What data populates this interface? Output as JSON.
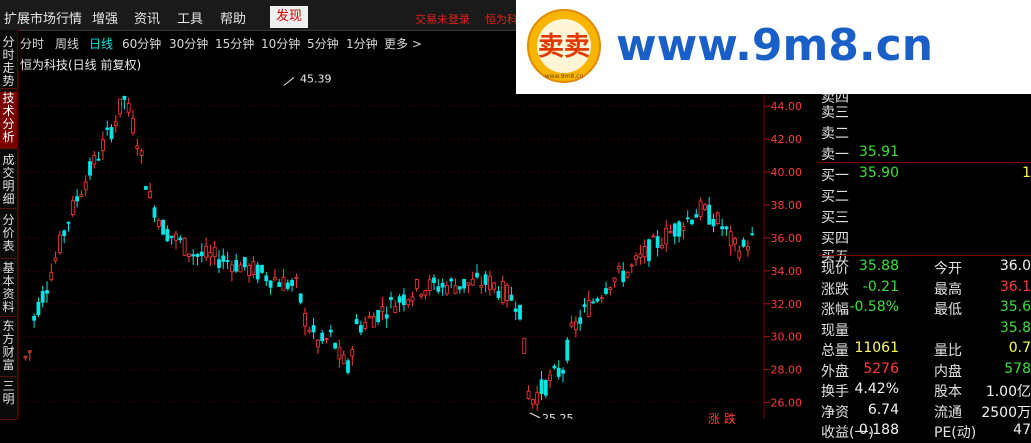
{
  "menu": {
    "items": [
      "扩展市场行情",
      "增强",
      "资讯",
      "工具",
      "帮助"
    ],
    "active": "发现",
    "login_status": "交易未登录",
    "stock_short": "恒为科"
  },
  "left_tabs": [
    "分时走势",
    "技术分析",
    "成交明细",
    "分价表",
    "基本资料",
    "东方财富",
    "三明"
  ],
  "periods": [
    "分时",
    "周线",
    "日线",
    "60分钟",
    "30分钟",
    "15分钟",
    "10分钟",
    "5分钟",
    "1分钟",
    "更多 >"
  ],
  "active_period": "日线",
  "chart_title": "恒为科技(日线 前复权)",
  "chart_data": {
    "type": "candlestick",
    "y_ticks": [
      26.0,
      28.0,
      30.0,
      32.0,
      34.0,
      36.0,
      38.0,
      40.0,
      42.0,
      44.0
    ],
    "ylim": [
      25.0,
      46.2
    ],
    "annotations": [
      {
        "label": "45.39",
        "value": 45.39
      },
      {
        "label": "25.25",
        "value": 25.25
      }
    ],
    "up_color": "#ff3b3b",
    "down_color": "#00e5e5"
  },
  "quote": {
    "asks": [
      {
        "label": "卖四",
        "price": "",
        "vol": ""
      },
      {
        "label": "卖三",
        "price": "",
        "vol": ""
      },
      {
        "label": "卖二",
        "price": "",
        "vol": ""
      },
      {
        "label": "卖一",
        "price": "35.91",
        "vol": ""
      }
    ],
    "bids": [
      {
        "label": "买一",
        "price": "35.90",
        "vol": "1"
      },
      {
        "label": "买二",
        "price": "",
        "vol": ""
      },
      {
        "label": "买三",
        "price": "",
        "vol": ""
      },
      {
        "label": "买四",
        "price": "",
        "vol": ""
      },
      {
        "label": "买五",
        "price": "",
        "vol": ""
      }
    ],
    "stats": [
      {
        "l1": "现价",
        "v1": "35.88",
        "c1": "green",
        "l2": "今开",
        "v2": "36.0",
        "c2": "white"
      },
      {
        "l1": "涨跌",
        "v1": "-0.21",
        "c1": "green",
        "l2": "最高",
        "v2": "36.1",
        "c2": "red"
      },
      {
        "l1": "涨幅",
        "v1": "-0.58%",
        "c1": "green",
        "l2": "最低",
        "v2": "35.6",
        "c2": "green"
      },
      {
        "l1": "现量",
        "v1": "",
        "c1": "white",
        "l2": "",
        "v2": "35.8",
        "c2": "green"
      },
      {
        "l1": "总量",
        "v1": "11061",
        "c1": "yellow",
        "l2": "量比",
        "v2": "0.7",
        "c2": "yellow"
      },
      {
        "l1": "外盘",
        "v1": "5276",
        "c1": "red",
        "l2": "内盘",
        "v2": "578",
        "c2": "green"
      },
      {
        "l1": "换手",
        "v1": "4.42%",
        "c1": "white",
        "l2": "股本",
        "v2": "1.00亿",
        "c2": "white"
      },
      {
        "l1": "净资",
        "v1": "6.74",
        "c1": "white",
        "l2": "流通",
        "v2": "2500万",
        "c2": "white"
      },
      {
        "l1": "收益(一)",
        "v1": "0.188",
        "c1": "white",
        "l2": "PE(动)",
        "v2": "47",
        "c2": "white"
      }
    ]
  },
  "bottom_tag": "涨 跌",
  "banner": {
    "url": "www.9m8.cn",
    "logo_text": "卖卖",
    "logo_caption": "www.9m8.cn"
  }
}
